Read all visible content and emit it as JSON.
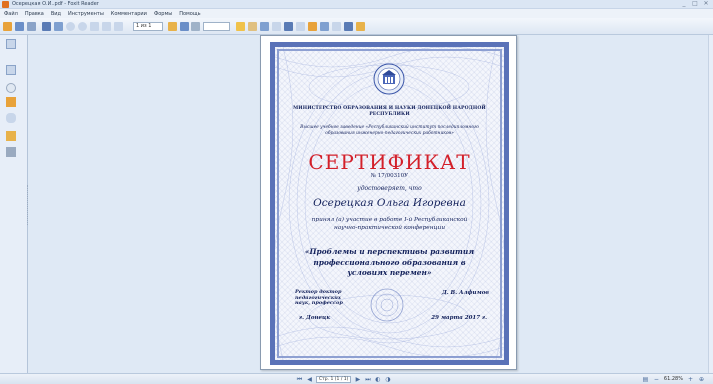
{
  "window": {
    "title": "Осерецкая О.И..pdf - Foxit Reader",
    "controls": [
      "_",
      "□",
      "✕"
    ]
  },
  "menu": [
    "Файл",
    "Правка",
    "Вид",
    "Инструменты",
    "Комментарии",
    "Формы",
    "Помощь"
  ],
  "toolbar": {
    "page_field": "1 из 1"
  },
  "certificate": {
    "ministry": "МИНИСТЕРСТВО ОБРАЗОВАНИЯ И НАУКИ ДОНЕЦКОЙ НАРОДНОЙ РЕСПУБЛИКИ",
    "institution": "Высшее учебное заведение «Республиканский институт последипломного образования инженерно-педагогических работников»",
    "title": "СЕРТИФИКАТ",
    "number": "№ 17/00310У",
    "certifies": "удостоверяет, что",
    "recipient": "Осерецкая Ольга Игоревна",
    "participation": "принял (а) участие в работе I-й Республиканской научно-практической конференции",
    "topic": "«Проблемы и перспективы развития профессионального образования в условиях перемен»",
    "rector": "Ректор доктор педагогических наук, профессор",
    "rector_name": "Д. В. Алфимов",
    "city": "г. Донецк",
    "date": "29 марта 2017 г."
  },
  "statusbar": {
    "page_indicator": "Стр. 1 (1 / 1)",
    "zoom": "61.28%"
  },
  "colors": {
    "accent": "#5a72b8",
    "title_red": "#d3202a",
    "chrome": "#dfe9f5"
  }
}
